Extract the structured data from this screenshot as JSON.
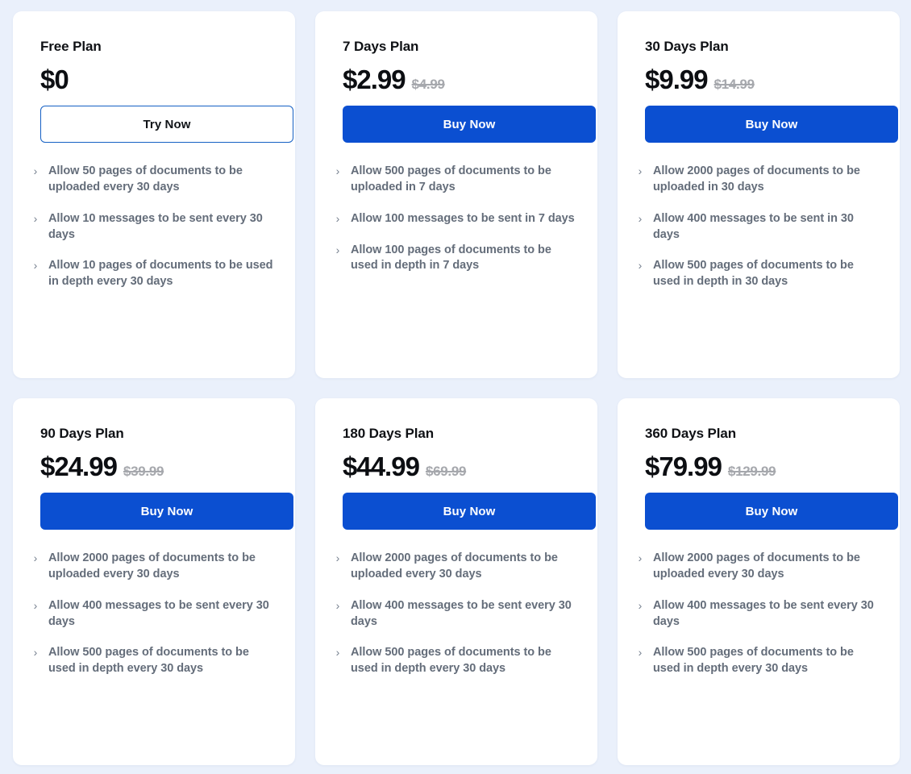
{
  "page": {
    "background_color": "#eaf0fb",
    "card_background": "#ffffff",
    "accent_color": "#0b4fd1",
    "outline_accent_color": "#1560c4",
    "muted_text_color": "#646d7a",
    "strikethrough_color": "#a6a8ad",
    "chevron_icon": "›"
  },
  "plans": [
    {
      "name": "Free Plan",
      "price": "$0",
      "original_price": "",
      "cta_label": "Try Now",
      "cta_style": "outline",
      "features": [
        "Allow 50 pages of documents to be uploaded every 30 days",
        "Allow 10 messages to be sent every 30 days",
        "Allow 10 pages of documents to be used in depth every 30 days"
      ]
    },
    {
      "name": "7 Days Plan",
      "price": "$2.99",
      "original_price": "$4.99",
      "cta_label": "Buy Now",
      "cta_style": "primary",
      "features": [
        "Allow 500 pages of documents to be uploaded in 7 days",
        "Allow 100 messages to be sent in 7 days",
        "Allow 100 pages of documents to be used in depth in 7 days"
      ]
    },
    {
      "name": "30 Days Plan",
      "price": "$9.99",
      "original_price": "$14.99",
      "cta_label": "Buy Now",
      "cta_style": "primary",
      "features": [
        "Allow 2000 pages of documents to be uploaded in 30 days",
        "Allow 400 messages to be sent in 30 days",
        "Allow 500 pages of documents to be used in depth in 30 days"
      ]
    },
    {
      "name": "90 Days Plan",
      "price": "$24.99",
      "original_price": "$39.99",
      "cta_label": "Buy Now",
      "cta_style": "primary",
      "features": [
        "Allow 2000 pages of documents to be uploaded every 30 days",
        "Allow 400 messages to be sent every 30 days",
        "Allow 500 pages of documents to be used in depth every 30 days"
      ]
    },
    {
      "name": "180 Days Plan",
      "price": "$44.99",
      "original_price": "$69.99",
      "cta_label": "Buy Now",
      "cta_style": "primary",
      "features": [
        "Allow 2000 pages of documents to be uploaded every 30 days",
        "Allow 400 messages to be sent every 30 days",
        "Allow 500 pages of documents to be used in depth every 30 days"
      ]
    },
    {
      "name": "360 Days Plan",
      "price": "$79.99",
      "original_price": "$129.99",
      "cta_label": "Buy Now",
      "cta_style": "primary",
      "features": [
        "Allow 2000 pages of documents to be uploaded every 30 days",
        "Allow 400 messages to be sent every 30 days",
        "Allow 500 pages of documents to be used in depth every 30 days"
      ]
    }
  ]
}
